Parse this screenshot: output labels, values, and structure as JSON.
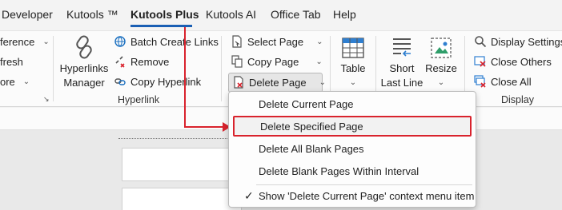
{
  "tabs": [
    {
      "label": "Developer"
    },
    {
      "label": "Kutools ™"
    },
    {
      "label": "Kutools Plus"
    },
    {
      "label": "Kutools AI"
    },
    {
      "label": "Office Tab"
    },
    {
      "label": "Help"
    }
  ],
  "ribbon": {
    "left_items": [
      "ference",
      "fresh",
      "ore"
    ],
    "hyperlink_group": {
      "big_button": {
        "line1": "Hyperlinks",
        "line2": "Manager",
        "icon": "chain-link-icon"
      },
      "items": [
        {
          "label": "Batch Create Links",
          "icon": "globe-link-icon"
        },
        {
          "label": "Remove",
          "icon": "broken-link-icon"
        },
        {
          "label": "Copy Hyperlink",
          "icon": "copy-link-icon"
        }
      ],
      "label": "Hyperlink"
    },
    "page_group": {
      "items": [
        {
          "label": "Select Page",
          "icon": "select-page-icon"
        },
        {
          "label": "Copy Page",
          "icon": "copy-page-icon"
        },
        {
          "label": "Delete Page",
          "icon": "delete-page-icon"
        }
      ]
    },
    "table": {
      "label": "Table",
      "icon": "table-icon"
    },
    "short_last_line": {
      "line1": "Short",
      "line2": "Last Line",
      "icon": "short-last-line-icon"
    },
    "resize": {
      "label": "Resize",
      "icon": "resize-image-icon"
    },
    "display_group": {
      "items": [
        {
          "label": "Display Settings",
          "icon": "magnifier-icon"
        },
        {
          "label": "Close Others",
          "icon": "close-others-icon"
        },
        {
          "label": "Close All",
          "icon": "close-all-icon"
        }
      ],
      "label": "Display"
    }
  },
  "menu": {
    "items": [
      {
        "label": "Delete Current Page"
      },
      {
        "label": "Delete Specified Page"
      },
      {
        "label": "Delete All Blank Pages"
      },
      {
        "label": "Delete Blank Pages Within Interval"
      },
      {
        "label": "Show 'Delete Current Page' context menu item"
      }
    ],
    "highlighted_index": 1
  },
  "colors": {
    "accent": "#1a5fb4",
    "highlight": "#d9232d"
  }
}
